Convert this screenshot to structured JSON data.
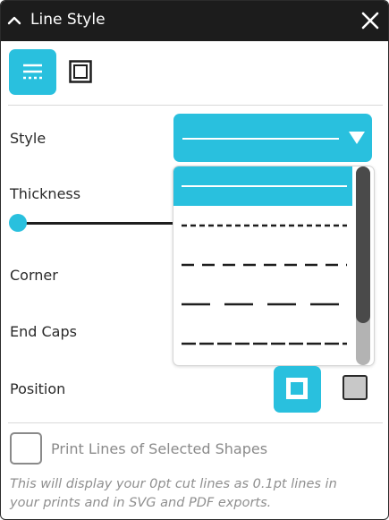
{
  "panel": {
    "title": "Line Style",
    "colors": {
      "accent": "#29c0de",
      "titlebar": "#1c1c1c",
      "text": "#2a2a2a",
      "muted": "#8a8a8a"
    }
  },
  "tabs": [
    {
      "name": "line-style-tab",
      "icon": "line-style-icon",
      "active": true
    },
    {
      "name": "border-tab",
      "icon": "square-border-icon",
      "active": false
    }
  ],
  "fields": {
    "style_label": "Style",
    "thickness_label": "Thickness",
    "corner_label": "Corner",
    "end_caps_label": "End Caps",
    "position_label": "Position"
  },
  "style_dropdown": {
    "selected": "solid",
    "options": [
      "solid",
      "fine-dash",
      "dash",
      "long-dash",
      "dense-dash"
    ]
  },
  "thickness": {
    "value": 0
  },
  "position": {
    "selected": "inside",
    "options": [
      "inside",
      "outside"
    ]
  },
  "print_lines": {
    "label": "Print Lines of Selected Shapes",
    "checked": false,
    "note_line1": "This will display your 0pt cut lines as 0.1pt lines in",
    "note_line2": "your prints and in SVG and PDF exports."
  }
}
